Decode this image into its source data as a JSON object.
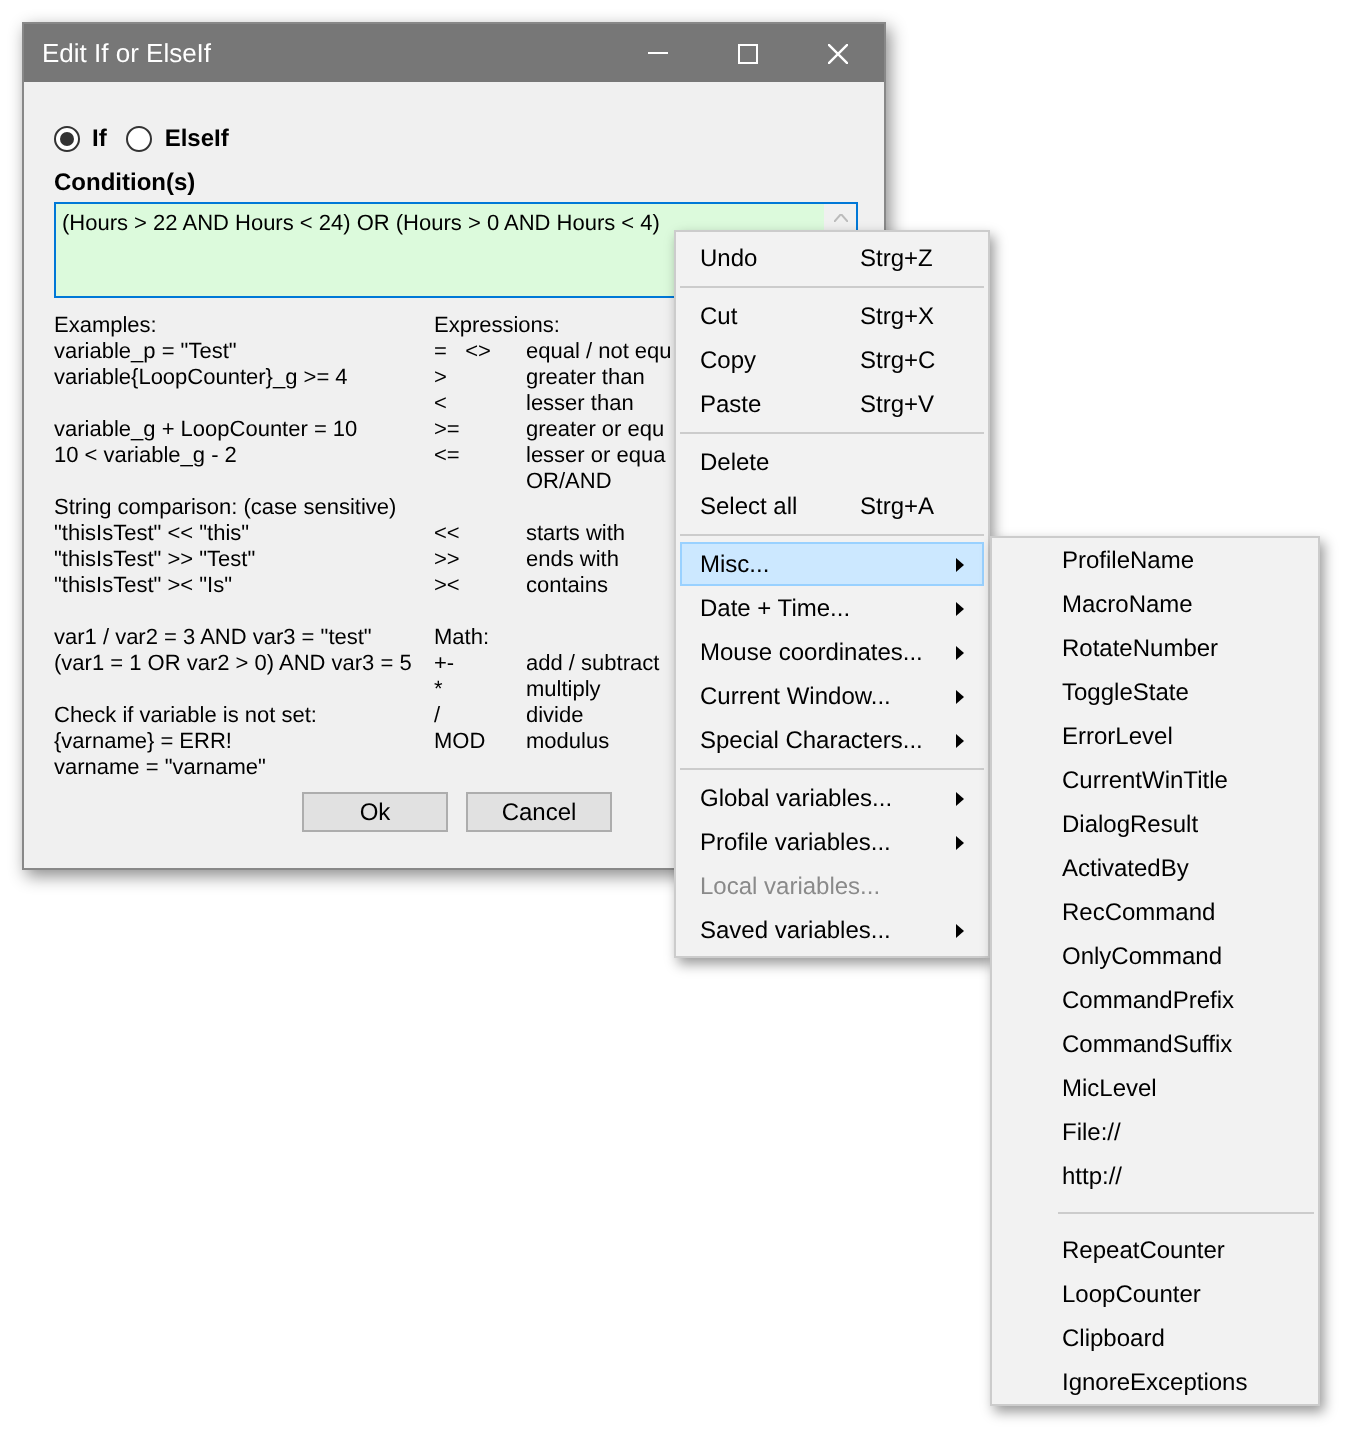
{
  "window": {
    "title": "Edit If or ElseIf"
  },
  "mode": [
    {
      "label": "If",
      "selected": true
    },
    {
      "label": "ElseIf",
      "selected": false
    }
  ],
  "condition": {
    "label": "Condition(s)",
    "value": "(Hours > 22 AND Hours < 24) OR (Hours > 0 AND Hours < 4)"
  },
  "help_rows": [
    {
      "example": "Examples:",
      "operator": "Expressions:"
    },
    {
      "example": "variable_p = \"Test\"",
      "operator": "=   <>",
      "meaning": "equal / not equ"
    },
    {
      "example": "variable{LoopCounter}_g >= 4",
      "operator": ">",
      "meaning": "greater than"
    },
    {
      "operator": "<",
      "meaning": "lesser than"
    },
    {
      "example": "variable_g + LoopCounter = 10",
      "operator": ">=",
      "meaning": "greater or equ"
    },
    {
      "example": "10 < variable_g - 2",
      "operator": "<=",
      "meaning": "lesser or equa"
    },
    {
      "meaning": "OR/AND"
    },
    {
      "example": "String comparison: (case sensitive)"
    },
    {
      "example": "\"thisIsTest\" << \"this\"",
      "operator": "<<",
      "meaning": "starts with"
    },
    {
      "example": "\"thisIsTest\" >> \"Test\"",
      "operator": ">>",
      "meaning": "ends with"
    },
    {
      "example": "\"thisIsTest\" >< \"Is\"",
      "operator": "><",
      "meaning": "contains"
    },
    {},
    {
      "example": "var1 / var2 = 3 AND var3 = \"test\"",
      "operator": "Math:"
    },
    {
      "example": "(var1 = 1 OR var2 > 0) AND var3 = 5",
      "operator": "+-",
      "meaning": "add / subtract"
    },
    {
      "operator": "*",
      "meaning": "multiply"
    },
    {
      "example": "Check if variable is not set:",
      "operator": "/",
      "meaning": "divide"
    },
    {
      "example": "{varname} = ERR!",
      "operator": "MOD",
      "meaning": "modulus"
    },
    {
      "example": "varname = \"varname\""
    }
  ],
  "buttons": [
    "Ok",
    "Cancel"
  ],
  "context_menu": [
    {
      "kind": "item",
      "label": "Undo",
      "shortcut": "Strg+Z",
      "submenu": false,
      "disabled": false,
      "selected": false
    },
    {
      "kind": "separator"
    },
    {
      "kind": "item",
      "label": "Cut",
      "shortcut": "Strg+X",
      "submenu": false,
      "disabled": false,
      "selected": false
    },
    {
      "kind": "item",
      "label": "Copy",
      "shortcut": "Strg+C",
      "submenu": false,
      "disabled": false,
      "selected": false
    },
    {
      "kind": "item",
      "label": "Paste",
      "shortcut": "Strg+V",
      "submenu": false,
      "disabled": false,
      "selected": false
    },
    {
      "kind": "separator"
    },
    {
      "kind": "item",
      "label": "Delete",
      "submenu": false,
      "disabled": false,
      "selected": false
    },
    {
      "kind": "item",
      "label": "Select all",
      "shortcut": "Strg+A",
      "submenu": false,
      "disabled": false,
      "selected": false
    },
    {
      "kind": "separator"
    },
    {
      "kind": "item",
      "label": "Misc...",
      "submenu": true,
      "disabled": false,
      "selected": true
    },
    {
      "kind": "item",
      "label": "Date + Time...",
      "submenu": true,
      "disabled": false,
      "selected": false
    },
    {
      "kind": "item",
      "label": "Mouse coordinates...",
      "submenu": true,
      "disabled": false,
      "selected": false
    },
    {
      "kind": "item",
      "label": "Current Window...",
      "submenu": true,
      "disabled": false,
      "selected": false
    },
    {
      "kind": "item",
      "label": "Special Characters...",
      "submenu": true,
      "disabled": false,
      "selected": false
    },
    {
      "kind": "separator"
    },
    {
      "kind": "item",
      "label": "Global variables...",
      "submenu": true,
      "disabled": false,
      "selected": false
    },
    {
      "kind": "item",
      "label": "Profile variables...",
      "submenu": true,
      "disabled": false,
      "selected": false
    },
    {
      "kind": "item",
      "label": "Local variables...",
      "submenu": false,
      "disabled": true,
      "selected": false
    },
    {
      "kind": "item",
      "label": "Saved variables...",
      "submenu": true,
      "disabled": false,
      "selected": false
    }
  ],
  "submenu": [
    {
      "kind": "item",
      "label": "ProfileName"
    },
    {
      "kind": "item",
      "label": "MacroName"
    },
    {
      "kind": "item",
      "label": "RotateNumber"
    },
    {
      "kind": "item",
      "label": "ToggleState"
    },
    {
      "kind": "item",
      "label": "ErrorLevel"
    },
    {
      "kind": "item",
      "label": "CurrentWinTitle"
    },
    {
      "kind": "item",
      "label": "DialogResult"
    },
    {
      "kind": "item",
      "label": "ActivatedBy"
    },
    {
      "kind": "item",
      "label": "RecCommand"
    },
    {
      "kind": "item",
      "label": "OnlyCommand"
    },
    {
      "kind": "item",
      "label": "CommandPrefix"
    },
    {
      "kind": "item",
      "label": "CommandSuffix"
    },
    {
      "kind": "item",
      "label": "MicLevel"
    },
    {
      "kind": "item",
      "label": "File://"
    },
    {
      "kind": "item",
      "label": "http://"
    },
    {
      "kind": "separator"
    },
    {
      "kind": "item",
      "label": "RepeatCounter"
    },
    {
      "kind": "item",
      "label": "LoopCounter"
    },
    {
      "kind": "item",
      "label": "Clipboard"
    },
    {
      "kind": "item",
      "label": "IgnoreExceptions"
    }
  ]
}
